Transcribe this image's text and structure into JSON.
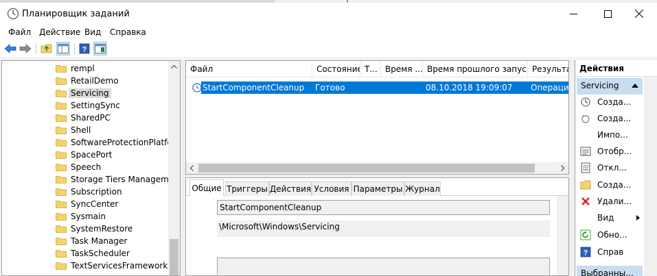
{
  "window": {
    "title": "Планировщик заданий"
  },
  "menu": [
    "Файл",
    "Действие",
    "Вид",
    "Справка"
  ],
  "tree": {
    "items": [
      "rempl",
      "RetailDemo",
      "Servicing",
      "SettingSync",
      "SharedPC",
      "Shell",
      "SoftwareProtectionPlatform",
      "SpacePort",
      "Speech",
      "Storage Tiers Management",
      "Subscription",
      "SyncCenter",
      "Sysmain",
      "SystemRestore",
      "Task Manager",
      "TaskScheduler",
      "TextServicesFramework"
    ],
    "selected": "Servicing"
  },
  "task_list": {
    "columns": [
      "Файл",
      "Состояние",
      "Т...",
      "Время ...",
      "Время прошлого запуска",
      "Результа..."
    ],
    "rows": [
      {
        "name": "StartComponentCleanup",
        "status": "Готово",
        "last_run": "08.10.2018 19:09:07",
        "result": "Операция"
      }
    ]
  },
  "details": {
    "tabs": [
      "Общие",
      "Триггеры",
      "Действия",
      "Условия",
      "Параметры",
      "Журнал"
    ],
    "active_tab": "Общие",
    "name_value": "StartComponentCleanup",
    "location_value": "\\Microsoft\\Windows\\Servicing"
  },
  "actions": {
    "header": "Действия",
    "group": "Servicing",
    "items": [
      "Созда...",
      "Созда...",
      "Импо...",
      "Отобр...",
      "Откл...",
      "Созда...",
      "Удали...",
      "Вид",
      "Обно...",
      "Справ"
    ],
    "group2": "Выбранны..."
  },
  "colors": {
    "selection": "#0078d7",
    "action_group": "#c9ddf2",
    "folder": "#f5d36b"
  }
}
